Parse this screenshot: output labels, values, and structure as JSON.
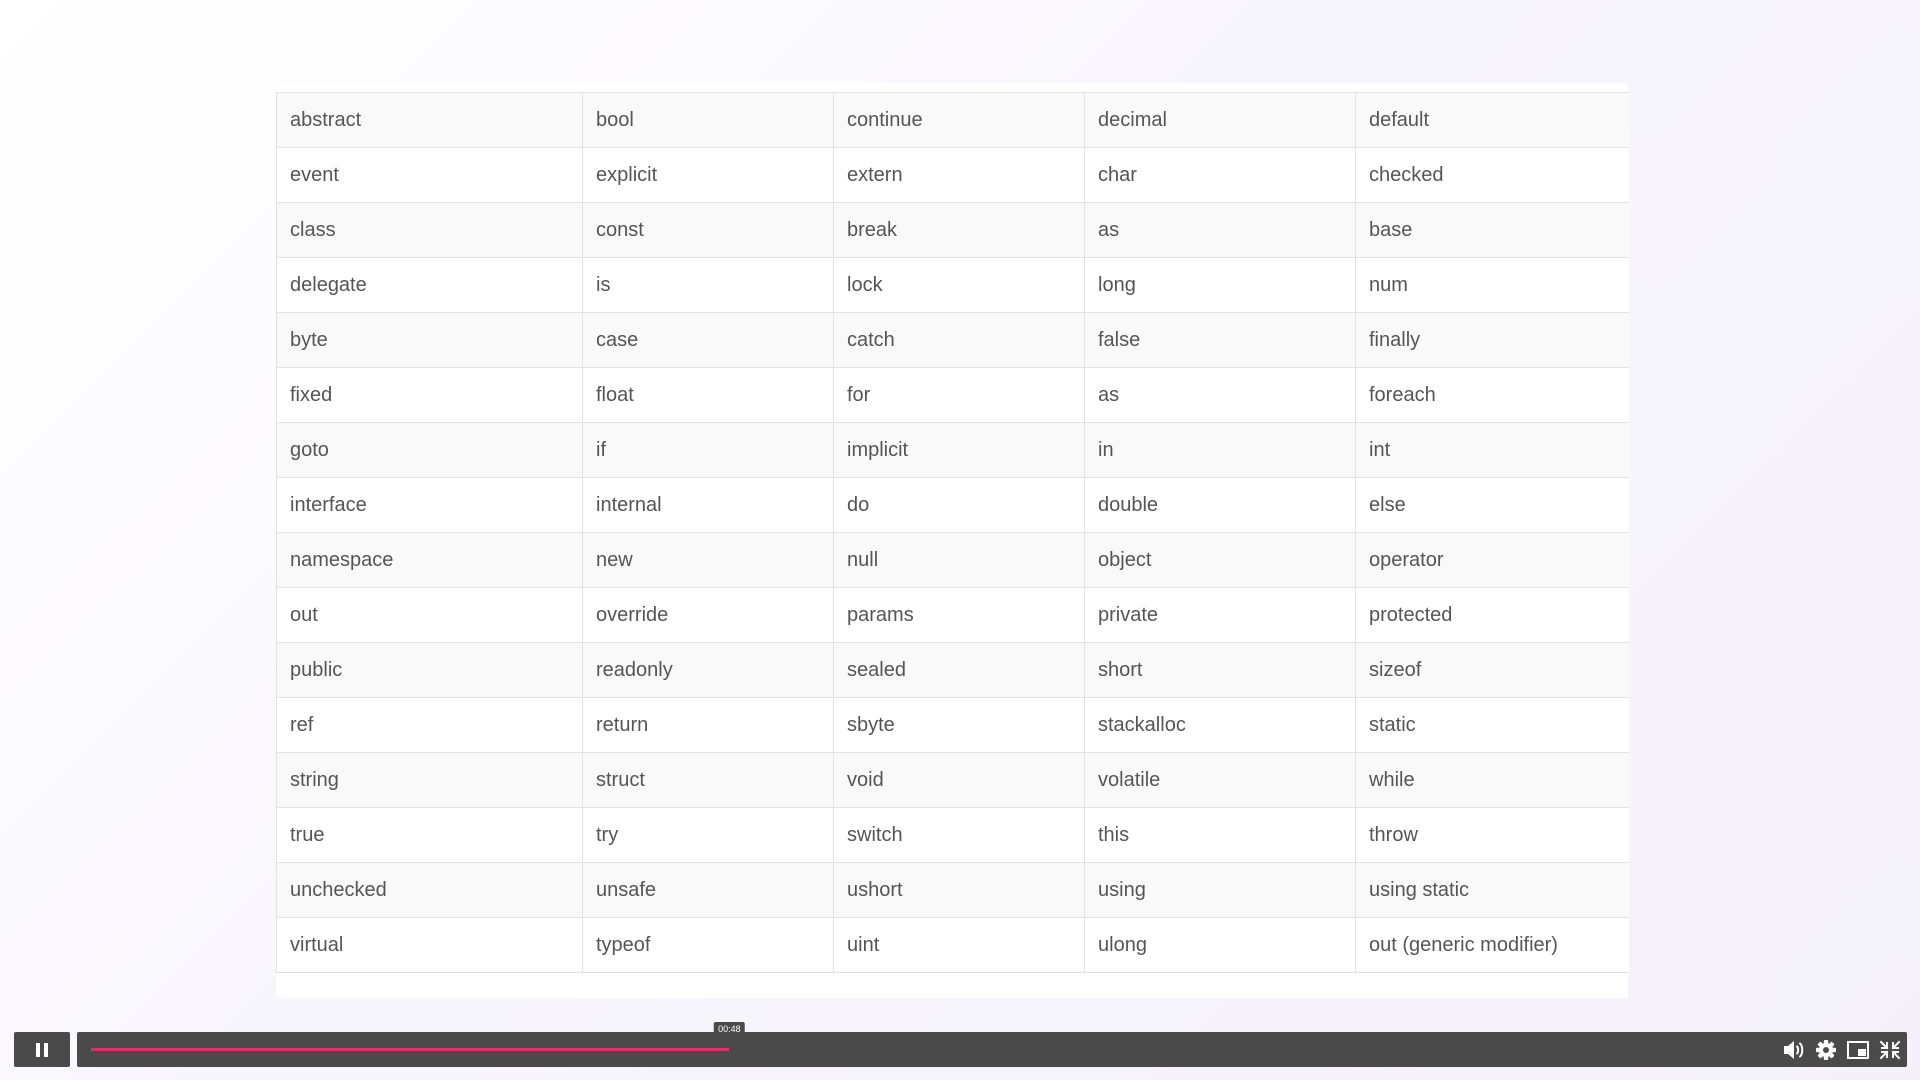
{
  "table": {
    "rows": [
      [
        "abstract",
        "bool",
        "continue",
        "decimal",
        "default"
      ],
      [
        "event",
        "explicit",
        "extern",
        "char",
        "checked"
      ],
      [
        "class",
        "const",
        "break",
        "as",
        "base"
      ],
      [
        "delegate",
        "is",
        "lock",
        "long",
        "num"
      ],
      [
        "byte",
        "case",
        "catch",
        "false",
        "finally"
      ],
      [
        "fixed",
        "float",
        "for",
        "as",
        "foreach"
      ],
      [
        "goto",
        "if",
        "implicit",
        "in",
        "int"
      ],
      [
        "interface",
        "internal",
        "do",
        "double",
        "else"
      ],
      [
        "namespace",
        "new",
        "null",
        "object",
        "operator"
      ],
      [
        "out",
        "override",
        "params",
        "private",
        "protected"
      ],
      [
        "public",
        "readonly",
        "sealed",
        "short",
        "sizeof"
      ],
      [
        "ref",
        "return",
        "sbyte",
        "stackalloc",
        "static"
      ],
      [
        "string",
        "struct",
        "void",
        "volatile",
        "while"
      ],
      [
        "true",
        "try",
        "switch",
        "this",
        "throw"
      ],
      [
        "unchecked",
        "unsafe",
        "ushort",
        "using",
        "using static"
      ],
      [
        "virtual",
        "typeof",
        "uint",
        "ulong",
        "out (generic modifier)"
      ]
    ]
  },
  "player": {
    "state": "playing",
    "play_button_icon": "pause-icon",
    "current_time": "00:48",
    "progress_fraction": 0.38,
    "progress_color": "#e0306a",
    "controls": [
      {
        "name": "volume-icon"
      },
      {
        "name": "settings-gear-icon"
      },
      {
        "name": "picture-in-picture-icon"
      },
      {
        "name": "exit-fullscreen-icon"
      }
    ]
  },
  "colors": {
    "control_bg": "#4a4a4a",
    "table_text": "#555555",
    "table_border": "#e2e2e2"
  }
}
